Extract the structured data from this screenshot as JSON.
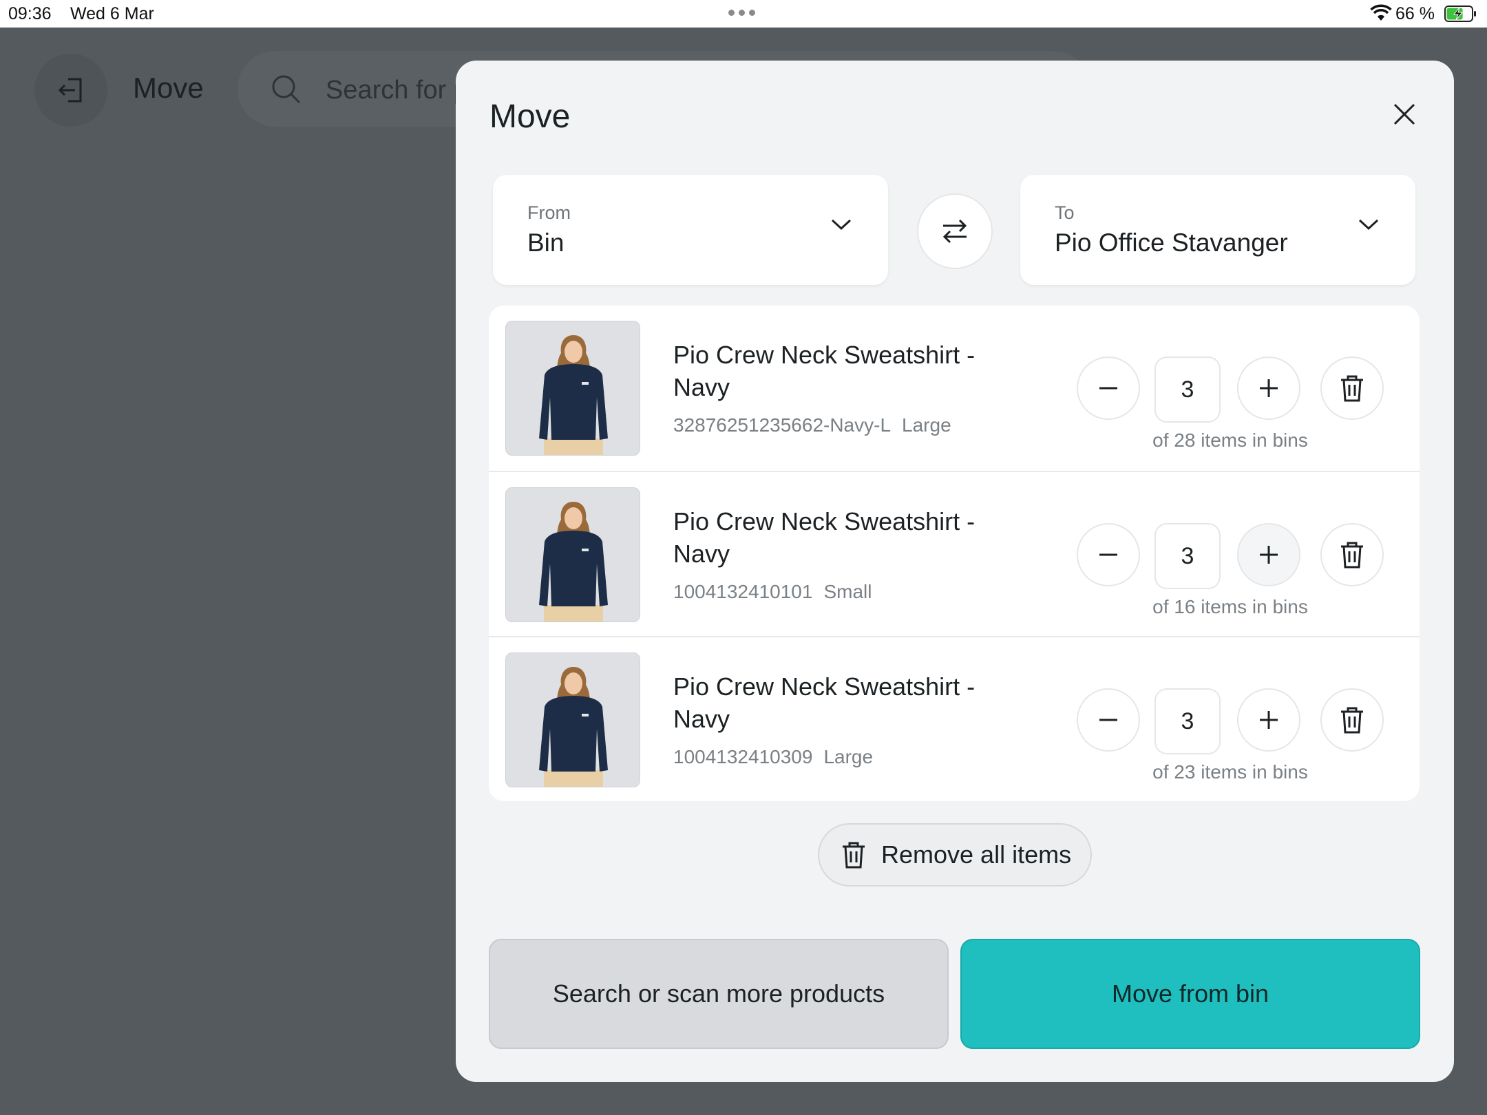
{
  "status_bar": {
    "time": "09:36",
    "date": "Wed 6 Mar",
    "battery_text": "66 %",
    "battery_level": 0.66
  },
  "background": {
    "title": "Move",
    "search_placeholder": "Search for p"
  },
  "modal": {
    "title": "Move",
    "from": {
      "label": "From",
      "value": "Bin"
    },
    "to": {
      "label": "To",
      "value": "Pio Office Stavanger"
    },
    "items": [
      {
        "name": "Pio Crew Neck Sweatshirt - Navy",
        "sku": "32876251235662-Navy-L",
        "size": "Large",
        "quantity": "3",
        "availability": "of 28 items in bins"
      },
      {
        "name": "Pio Crew Neck Sweatshirt - Navy",
        "sku": "1004132410101",
        "size": "Small",
        "quantity": "3",
        "availability": "of 16 items in bins"
      },
      {
        "name": "Pio Crew Neck Sweatshirt - Navy",
        "sku": "1004132410309",
        "size": "Large",
        "quantity": "3",
        "availability": "of 23 items in bins"
      }
    ],
    "remove_all_label": "Remove all items",
    "secondary_button": "Search or scan more products",
    "primary_button": "Move from bin"
  },
  "colors": {
    "primary": "#1ebfbe",
    "overlay": "#545a5e",
    "modal_bg": "#f2f3f4"
  }
}
